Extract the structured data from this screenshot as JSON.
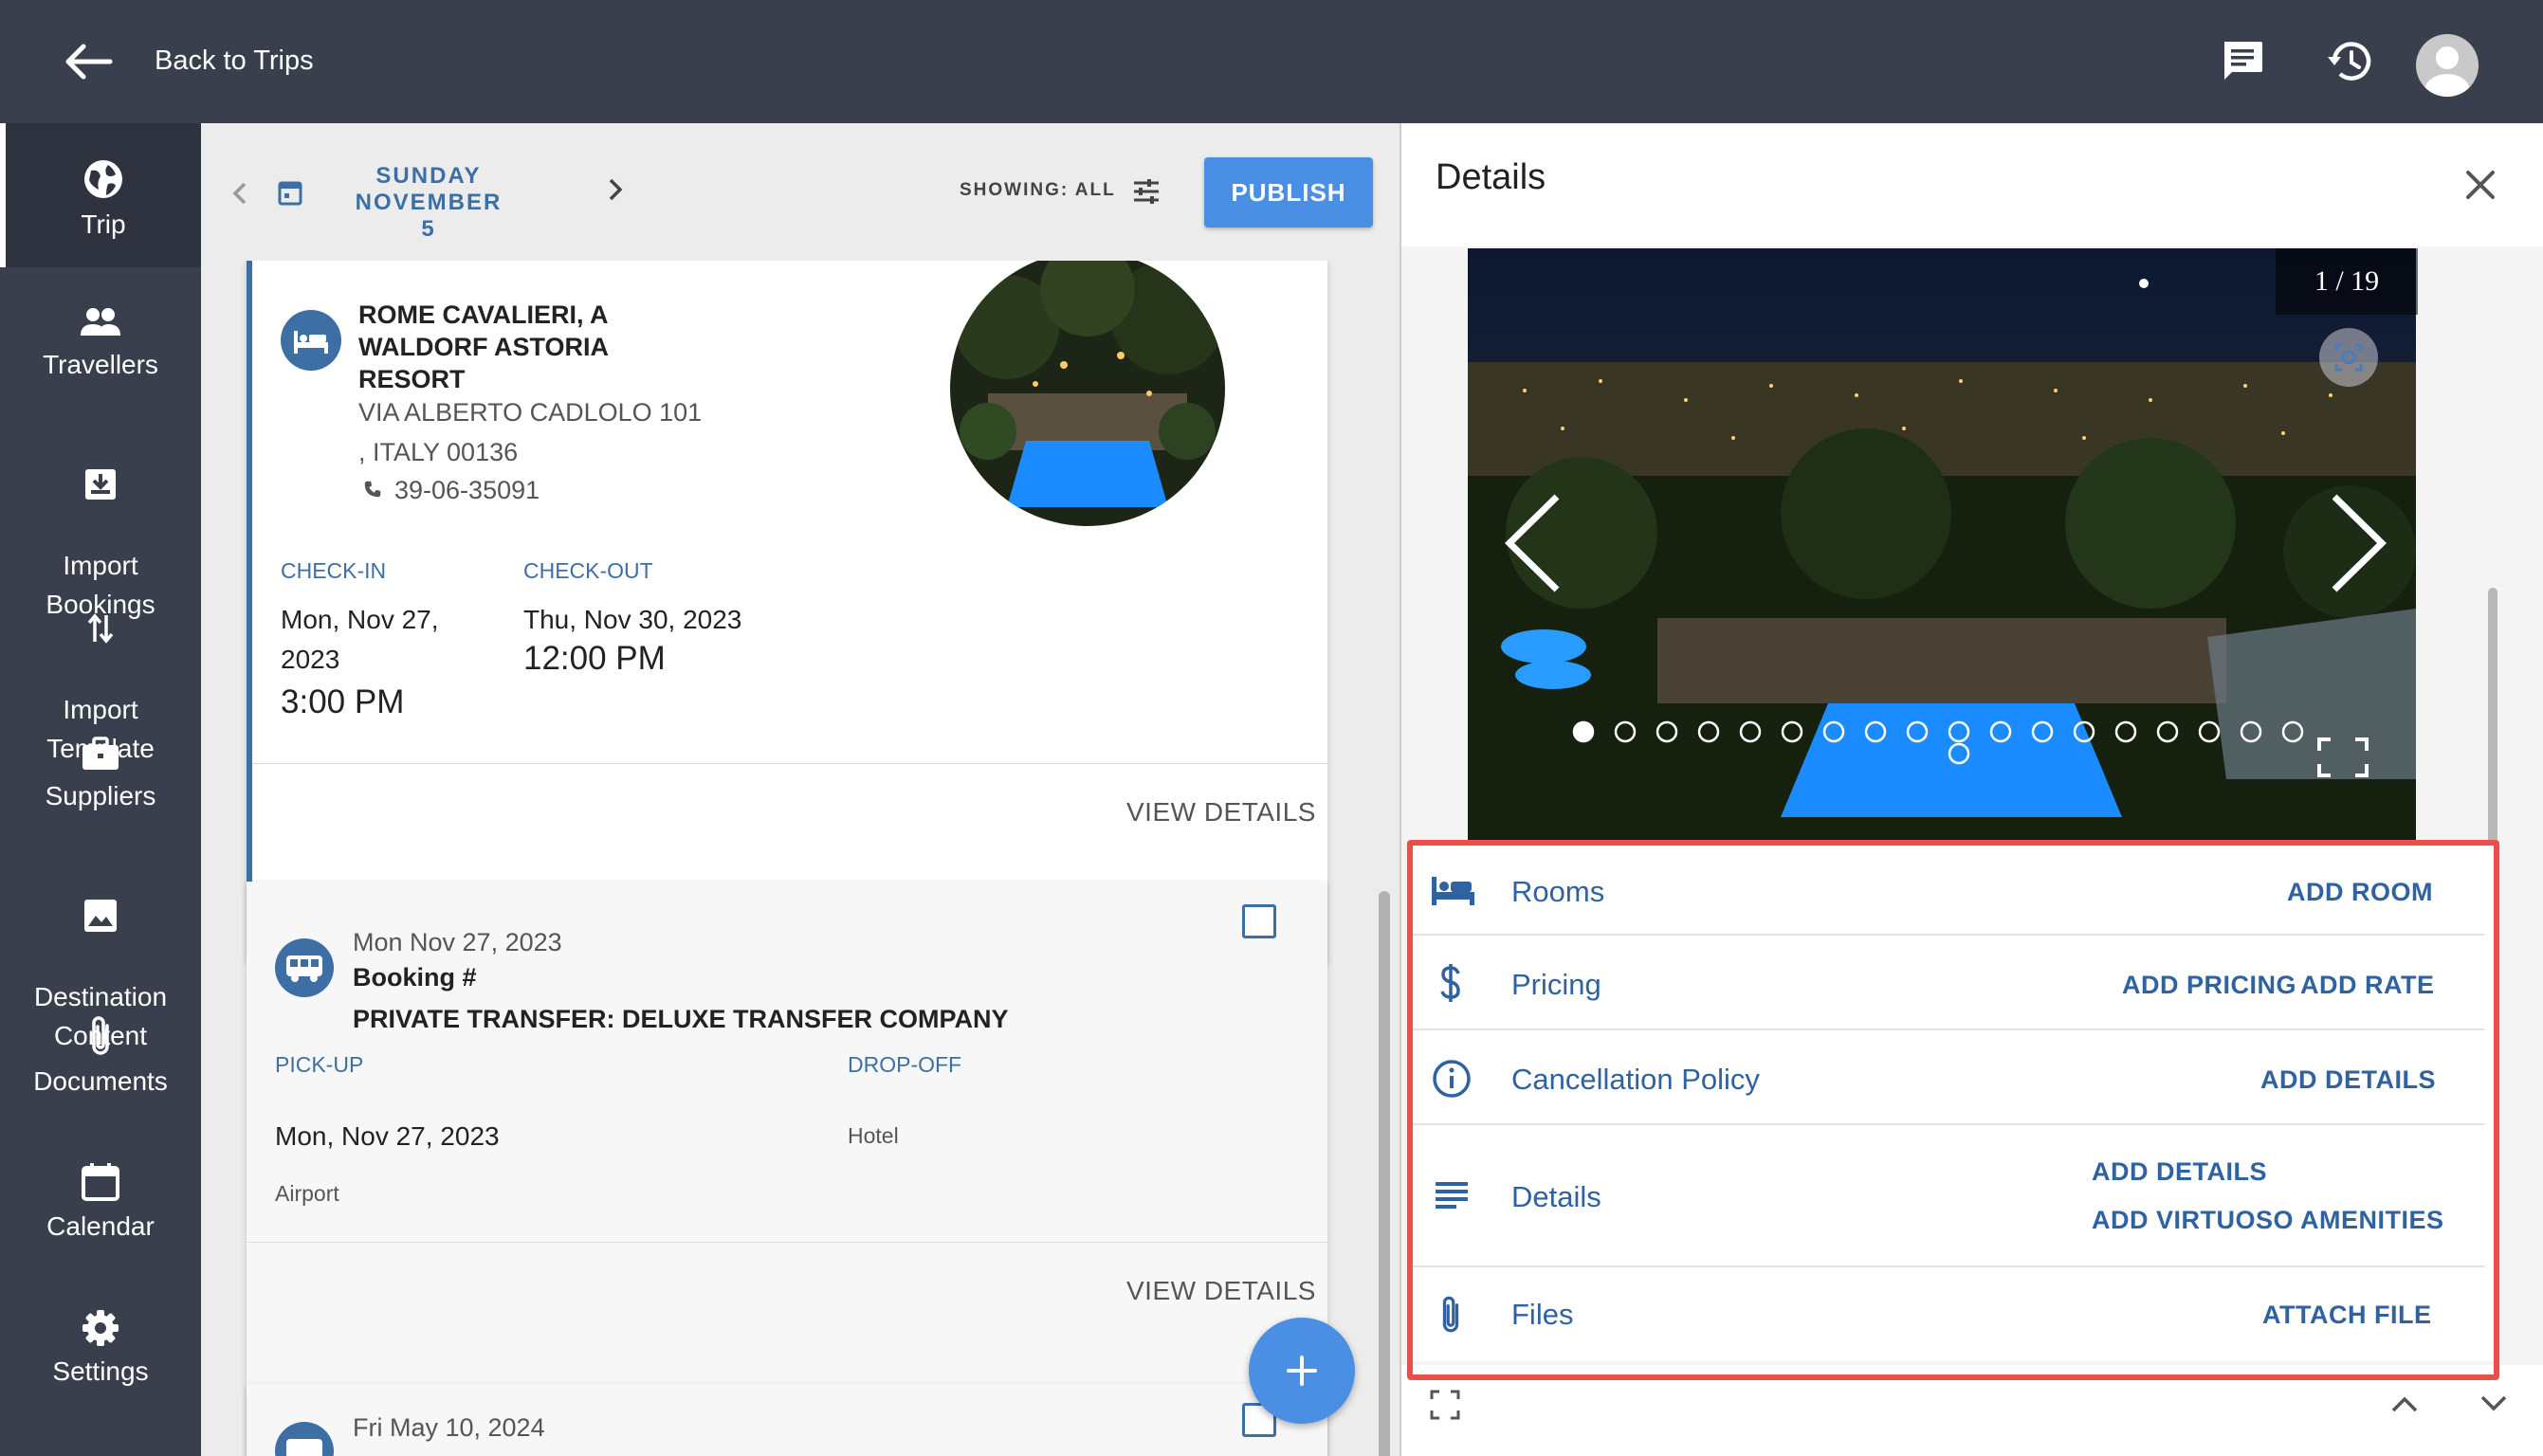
{
  "topbar": {
    "back_label": "Back to Trips",
    "icons": [
      "arrow-left-icon",
      "chat-icon",
      "history-icon",
      "avatar"
    ]
  },
  "nav": {
    "items": [
      {
        "label": "Trip",
        "icon": "globe-icon"
      },
      {
        "label": "Travellers",
        "icon": "people-icon"
      },
      {
        "label": "Import\nBookings",
        "icon": "import-icon"
      },
      {
        "label": "Import\nTemplate",
        "icon": "swap-vertical-icon"
      },
      {
        "label": "Suppliers",
        "icon": "briefcase-icon"
      },
      {
        "label": "Destination\nContent",
        "icon": "image-icon"
      },
      {
        "label": "Documents",
        "icon": "paperclip-icon"
      },
      {
        "label": "Calendar",
        "icon": "calendar-icon"
      },
      {
        "label": "Settings",
        "icon": "gear-icon"
      }
    ]
  },
  "datebar": {
    "date_line1": "SUNDAY NOVEMBER",
    "date_line2": "5",
    "showing": "SHOWING: ALL",
    "publish": "PUBLISH"
  },
  "hotel_card": {
    "name_line1": "ROME CAVALIERI, A",
    "name_line2": "WALDORF ASTORIA",
    "name_line3": "RESORT",
    "address_line1": "VIA ALBERTO CADLOLO 101",
    "address_line2": ", ITALY 00136",
    "phone": "39-06-35091",
    "checkin_label": "CHECK-IN",
    "checkout_label": "CHECK-OUT",
    "checkin_date_line1": "Mon, Nov 27,",
    "checkin_date_line2": "2023",
    "checkin_time": "3:00 PM",
    "checkout_date": "Thu, Nov 30, 2023",
    "checkout_time": "12:00 PM",
    "view_details": "VIEW DETAILS"
  },
  "transfer_card": {
    "date": "Mon Nov 27, 2023",
    "booking": "Booking #",
    "title": "PRIVATE TRANSFER: DELUXE TRANSFER COMPANY",
    "pickup_label": "PICK-UP",
    "dropoff_label": "DROP-OFF",
    "pickup_date": "Mon, Nov 27, 2023",
    "pickup_place": "Airport",
    "dropoff_place": "Hotel",
    "view_details": "VIEW DETAILS"
  },
  "third_card": {
    "date": "Fri May 10, 2024"
  },
  "details": {
    "title": "Details",
    "counter": "1 / 19",
    "photo_count": 19,
    "active_photo": 1,
    "rows": [
      {
        "label": "Rooms",
        "icon": "bed-icon",
        "actions": [
          "ADD ROOM"
        ]
      },
      {
        "label": "Pricing",
        "icon": "dollar-icon",
        "actions": [
          "ADD PRICING",
          "ADD RATE"
        ]
      },
      {
        "label": "Cancellation Policy",
        "icon": "info-icon",
        "actions": [
          "ADD DETAILS"
        ]
      },
      {
        "label": "Details",
        "icon": "lines-icon",
        "actions": [
          "ADD DETAILS",
          "ADD VIRTUOSO AMENITIES"
        ]
      },
      {
        "label": "Files",
        "icon": "paperclip-icon",
        "actions": [
          "ATTACH FILE"
        ]
      }
    ]
  },
  "colors": {
    "topbar": "#3a3f4d",
    "accent": "#3d6fa5",
    "publish": "#4a8fe3",
    "highlight": "#e8504b"
  }
}
